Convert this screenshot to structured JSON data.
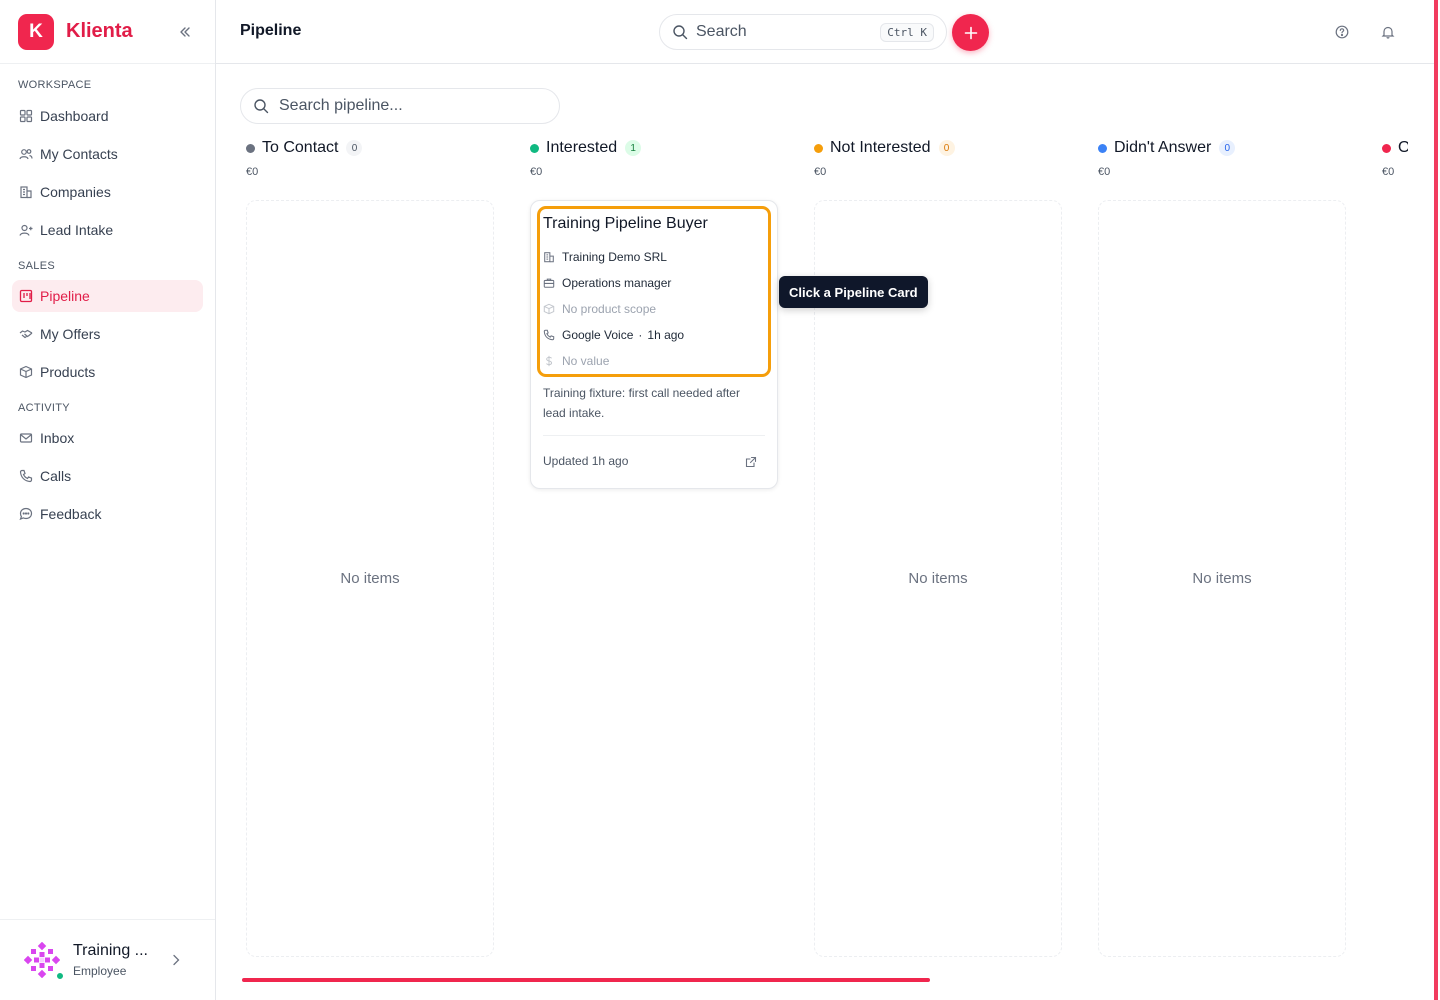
{
  "brand": {
    "logo_letter": "K",
    "name": "Klienta",
    "accent": "#f0264e"
  },
  "sidebar": {
    "sections": [
      {
        "label": "WORKSPACE",
        "items": [
          {
            "label": "Dashboard",
            "icon": "grid-icon"
          },
          {
            "label": "My Contacts",
            "icon": "users-icon"
          },
          {
            "label": "Companies",
            "icon": "building-icon"
          },
          {
            "label": "Lead Intake",
            "icon": "user-plus-icon"
          }
        ]
      },
      {
        "label": "SALES",
        "items": [
          {
            "label": "Pipeline",
            "icon": "kanban-icon",
            "active": true
          },
          {
            "label": "My Offers",
            "icon": "handshake-icon"
          },
          {
            "label": "Products",
            "icon": "package-icon"
          }
        ]
      },
      {
        "label": "ACTIVITY",
        "items": [
          {
            "label": "Inbox",
            "icon": "mail-icon"
          },
          {
            "label": "Calls",
            "icon": "phone-icon"
          },
          {
            "label": "Feedback",
            "icon": "message-icon"
          }
        ]
      }
    ],
    "user": {
      "name": "Training ...",
      "role": "Employee",
      "status": "online"
    }
  },
  "topbar": {
    "title": "Pipeline",
    "search": {
      "placeholder": "Search",
      "shortcut": "Ctrl K"
    }
  },
  "pipeline": {
    "search_placeholder": "Search pipeline...",
    "empty_text": "No items",
    "columns": [
      {
        "title": "To Contact",
        "count": "0",
        "sum": "€0",
        "color": "#6b7280",
        "count_bg": "#f3f4f6",
        "count_fg": "#4b5563"
      },
      {
        "title": "Interested",
        "count": "1",
        "sum": "€0",
        "color": "#10b981",
        "count_bg": "#dcfce7",
        "count_fg": "#15803d"
      },
      {
        "title": "Not Interested",
        "count": "0",
        "sum": "€0",
        "color": "#f59e0b",
        "count_bg": "#fef3e2",
        "count_fg": "#d97706"
      },
      {
        "title": "Didn't Answer",
        "count": "0",
        "sum": "€0",
        "color": "#3b82f6",
        "count_bg": "#e8f0fe",
        "count_fg": "#2563eb"
      },
      {
        "title": "O",
        "count": "",
        "sum": "€0",
        "color": "#f0264e",
        "count_bg": "transparent",
        "count_fg": "transparent"
      }
    ],
    "card": {
      "title": "Training Pipeline Buyer",
      "company": "Training Demo SRL",
      "role": "Operations manager",
      "product": "No product scope",
      "call_source": "Google Voice",
      "call_time": "1h ago",
      "value": "No value",
      "description": "Training fixture: first call needed after lead intake.",
      "updated": "Updated 1h ago"
    },
    "tooltip": "Click a Pipeline Card",
    "scroll_progress": 0.59
  }
}
